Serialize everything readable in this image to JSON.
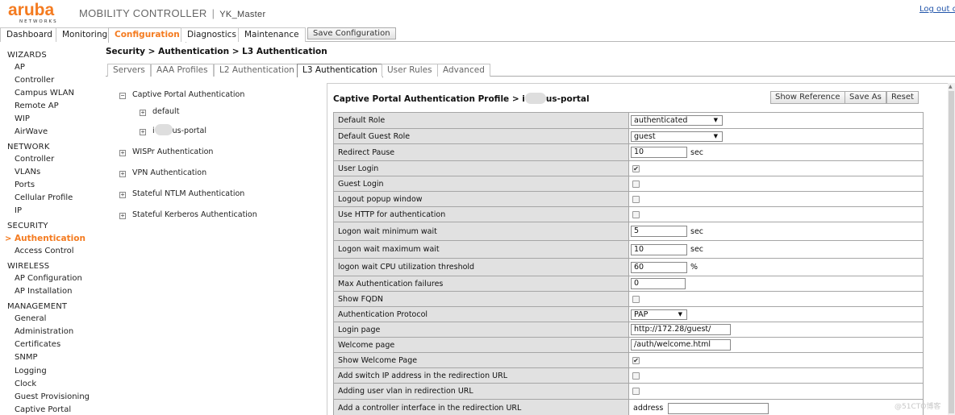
{
  "header": {
    "logo_text": "aruba",
    "logo_sub": "NETWORKS",
    "app_title": "MOBILITY CONTROLLER",
    "separator": "|",
    "hostname": "YK_Master",
    "logout": "Log out c"
  },
  "topnav": {
    "tabs": [
      "Dashboard",
      "Monitoring",
      "Configuration",
      "Diagnostics",
      "Maintenance"
    ],
    "active": "Configuration",
    "save_config": "Save Configuration"
  },
  "sidebar": {
    "sections": [
      {
        "title": "WIZARDS",
        "items": [
          "AP",
          "Controller",
          "Campus WLAN",
          "Remote AP",
          "WIP",
          "AirWave"
        ]
      },
      {
        "title": "NETWORK",
        "items": [
          "Controller",
          "VLANs",
          "Ports",
          "Cellular Profile",
          "IP"
        ]
      },
      {
        "title": "SECURITY",
        "items": [
          "Authentication",
          "Access Control"
        ]
      },
      {
        "title": "WIRELESS",
        "items": [
          "AP Configuration",
          "AP Installation"
        ]
      },
      {
        "title": "MANAGEMENT",
        "items": [
          "General",
          "Administration",
          "Certificates",
          "SNMP",
          "Logging",
          "Clock",
          "Guest Provisioning",
          "Captive Portal"
        ]
      }
    ],
    "active_marker": ">"
  },
  "breadcrumb": "Security > Authentication > L3 Authentication",
  "subtabs": {
    "items": [
      "Servers",
      "AAA Profiles",
      "L2 Authentication",
      "L3 Authentication",
      "User Rules",
      "Advanced"
    ],
    "active": "L3 Authentication"
  },
  "tree": {
    "root": "Captive Portal Authentication",
    "children": [
      "default",
      "us-portal"
    ],
    "child_prefix": "i",
    "others": [
      "WISPr Authentication",
      "VPN Authentication",
      "Stateful NTLM Authentication",
      "Stateful Kerberos Authentication"
    ],
    "expand_sym": "+",
    "collapse_sym": "−"
  },
  "panel": {
    "title_prefix": "Captive Portal Authentication Profile > i",
    "title_suffix": "us-portal",
    "buttons": [
      "Show Reference",
      "Save As",
      "Reset"
    ]
  },
  "form": {
    "check_mark": "✔",
    "rows": [
      {
        "label": "Default Role",
        "type": "select",
        "value": "authenticated"
      },
      {
        "label": "Default Guest Role",
        "type": "select",
        "value": "guest"
      },
      {
        "label": "Redirect Pause",
        "type": "text",
        "value": "10",
        "unit": "sec"
      },
      {
        "label": "User Login",
        "type": "checkbox",
        "checked": true
      },
      {
        "label": "Guest Login",
        "type": "checkbox",
        "checked": false
      },
      {
        "label": "Logout popup window",
        "type": "checkbox",
        "checked": false
      },
      {
        "label": "Use HTTP for authentication",
        "type": "checkbox",
        "checked": false
      },
      {
        "label": "Logon wait minimum wait",
        "type": "text",
        "value": "5",
        "unit": "sec"
      },
      {
        "label": "Logon wait maximum wait",
        "type": "text",
        "value": "10",
        "unit": "sec"
      },
      {
        "label": "logon wait CPU utilization threshold",
        "type": "text",
        "value": "60",
        "unit": "%"
      },
      {
        "label": "Max Authentication failures",
        "type": "text",
        "value": "0"
      },
      {
        "label": "Show FQDN",
        "type": "checkbox",
        "checked": false
      },
      {
        "label": "Authentication Protocol",
        "type": "select",
        "value": "PAP"
      },
      {
        "label": "Login page",
        "type": "text",
        "value": "http://172.28/guest/"
      },
      {
        "label": "Welcome page",
        "type": "text",
        "value": "/auth/welcome.html"
      },
      {
        "label": "Show Welcome Page",
        "type": "checkbox",
        "checked": true
      },
      {
        "label": "Add switch IP address in the redirection URL",
        "type": "checkbox",
        "checked": false
      },
      {
        "label": "Adding user vlan in redirection URL",
        "type": "checkbox",
        "checked": false
      },
      {
        "label": "Add a controller interface in the redirection URL",
        "type": "text",
        "prefix": "address",
        "value": ""
      }
    ]
  },
  "watermark": "@51CTO博客"
}
